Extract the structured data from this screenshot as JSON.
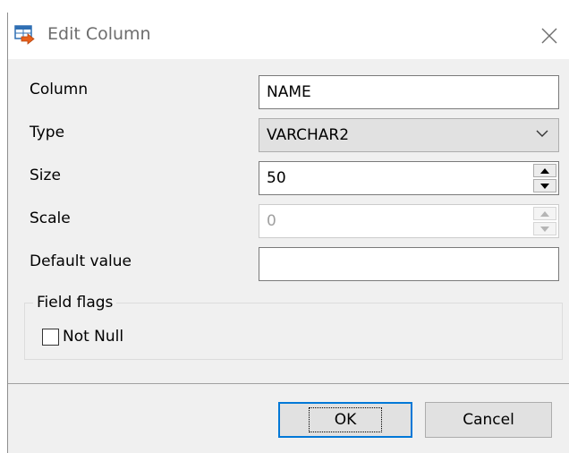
{
  "window": {
    "title": "Edit Column"
  },
  "form": {
    "column": {
      "label": "Column",
      "value": "NAME"
    },
    "type": {
      "label": "Type",
      "value": "VARCHAR2"
    },
    "size": {
      "label": "Size",
      "value": "50"
    },
    "scale": {
      "label": "Scale",
      "value": "0"
    },
    "default_value": {
      "label": "Default value",
      "value": ""
    }
  },
  "field_flags": {
    "legend": "Field flags",
    "not_null": {
      "label": "Not Null",
      "checked": false
    }
  },
  "buttons": {
    "ok": "OK",
    "cancel": "Cancel"
  },
  "icons": {
    "title": "table-edit-icon",
    "close": "close-icon",
    "dropdown": "chevron-down-icon",
    "spin_up": "spin-up-icon",
    "spin_down": "spin-down-icon"
  },
  "colors": {
    "accent": "#0078d7",
    "dialog_bg": "#f0f0f0",
    "disabled_text": "#a0a0a0"
  }
}
